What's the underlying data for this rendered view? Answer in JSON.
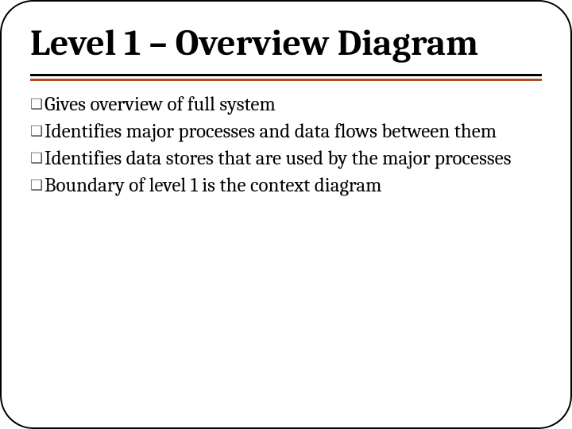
{
  "slide": {
    "title": "Level 1 – Overview Diagram",
    "bullets": [
      "Gives overview of full system",
      "Identifies major processes and data flows between them",
      "Identifies data stores that are used by the major processes",
      "Boundary of level 1 is the context diagram"
    ]
  }
}
